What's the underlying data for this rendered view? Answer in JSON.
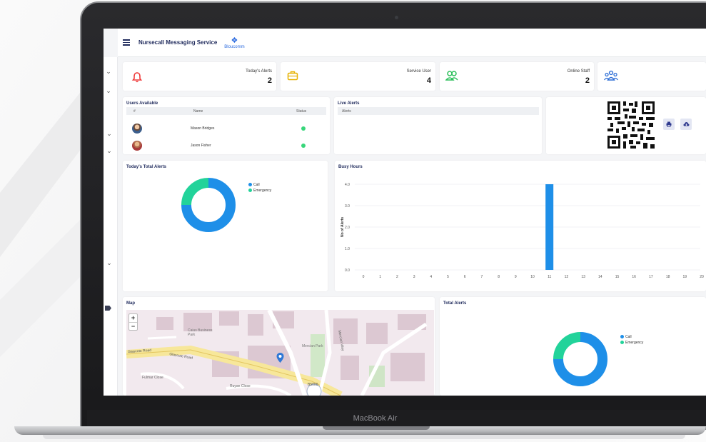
{
  "app": {
    "title": "Nursecall Messaging Service",
    "logo_text": "Bloucomm"
  },
  "device": {
    "label": "MacBook Air"
  },
  "stats": [
    {
      "label": "Today's Alerts",
      "value": "2",
      "icon": "bell-icon",
      "color": "#ef3b3b"
    },
    {
      "label": "Service User",
      "value": "4",
      "icon": "briefcase-icon",
      "color": "#e6b100"
    },
    {
      "label": "Online Staff",
      "value": "2",
      "icon": "users-icon",
      "color": "#2bbf5a"
    },
    {
      "label": "",
      "value": "",
      "icon": "group-icon",
      "color": "#2f6fd6"
    }
  ],
  "users_available": {
    "title": "Users Available",
    "columns": [
      "#",
      "Name",
      "Status"
    ],
    "rows": [
      {
        "name": "Mason Bridges",
        "status": "online"
      },
      {
        "name": "Jason Fisher",
        "status": "online"
      }
    ]
  },
  "live_alerts": {
    "title": "Live Alerts",
    "column": "Alerts"
  },
  "todays_total_alerts": {
    "title": "Today's Total Alerts",
    "legend": [
      "Call",
      "Emergency"
    ]
  },
  "busy_hours": {
    "title": "Busy Hours"
  },
  "map": {
    "title": "Map",
    "zoom_in": "+",
    "zoom_out": "−",
    "labels": {
      "road_a": "Glascote Road",
      "road_b": "Glascote Road",
      "street": "Fulmar Close",
      "park": "Caius Business Park",
      "close": "Ruyan Close",
      "ward": "Mercian Park",
      "way": "Mercian Way",
      "code": "B5000"
    }
  },
  "total_alerts": {
    "title": "Total Alerts",
    "legend": [
      "Call",
      "Emergency"
    ]
  },
  "chart_data": [
    {
      "type": "pie",
      "title": "Today's Total Alerts",
      "labels": [
        "Call",
        "Emergency"
      ],
      "values": [
        75,
        25
      ],
      "colors": [
        "#1e8fe8",
        "#22d39a"
      ],
      "legend": "top-right"
    },
    {
      "type": "bar",
      "title": "Busy Hours",
      "ylabel": "No of Alerts",
      "categories": [
        "0",
        "1",
        "2",
        "3",
        "4",
        "5",
        "6",
        "7",
        "8",
        "9",
        "10",
        "11",
        "12",
        "13",
        "14",
        "15",
        "16",
        "17",
        "18",
        "19",
        "20"
      ],
      "values": [
        0,
        0,
        0,
        0,
        0,
        0,
        0,
        0,
        0,
        0,
        0,
        4,
        0,
        0,
        0,
        0,
        0,
        0,
        0,
        0,
        0
      ],
      "ylim": [
        0,
        4
      ],
      "yticks": [
        "0.0",
        "1.0",
        "2.0",
        "3.0",
        "4.0"
      ],
      "grid": true,
      "color": "#1e8fe8"
    },
    {
      "type": "pie",
      "title": "Total Alerts",
      "labels": [
        "Call",
        "Emergency"
      ],
      "values": [
        75,
        25
      ],
      "colors": [
        "#1e8fe8",
        "#22d39a"
      ],
      "legend": "top-right"
    }
  ]
}
